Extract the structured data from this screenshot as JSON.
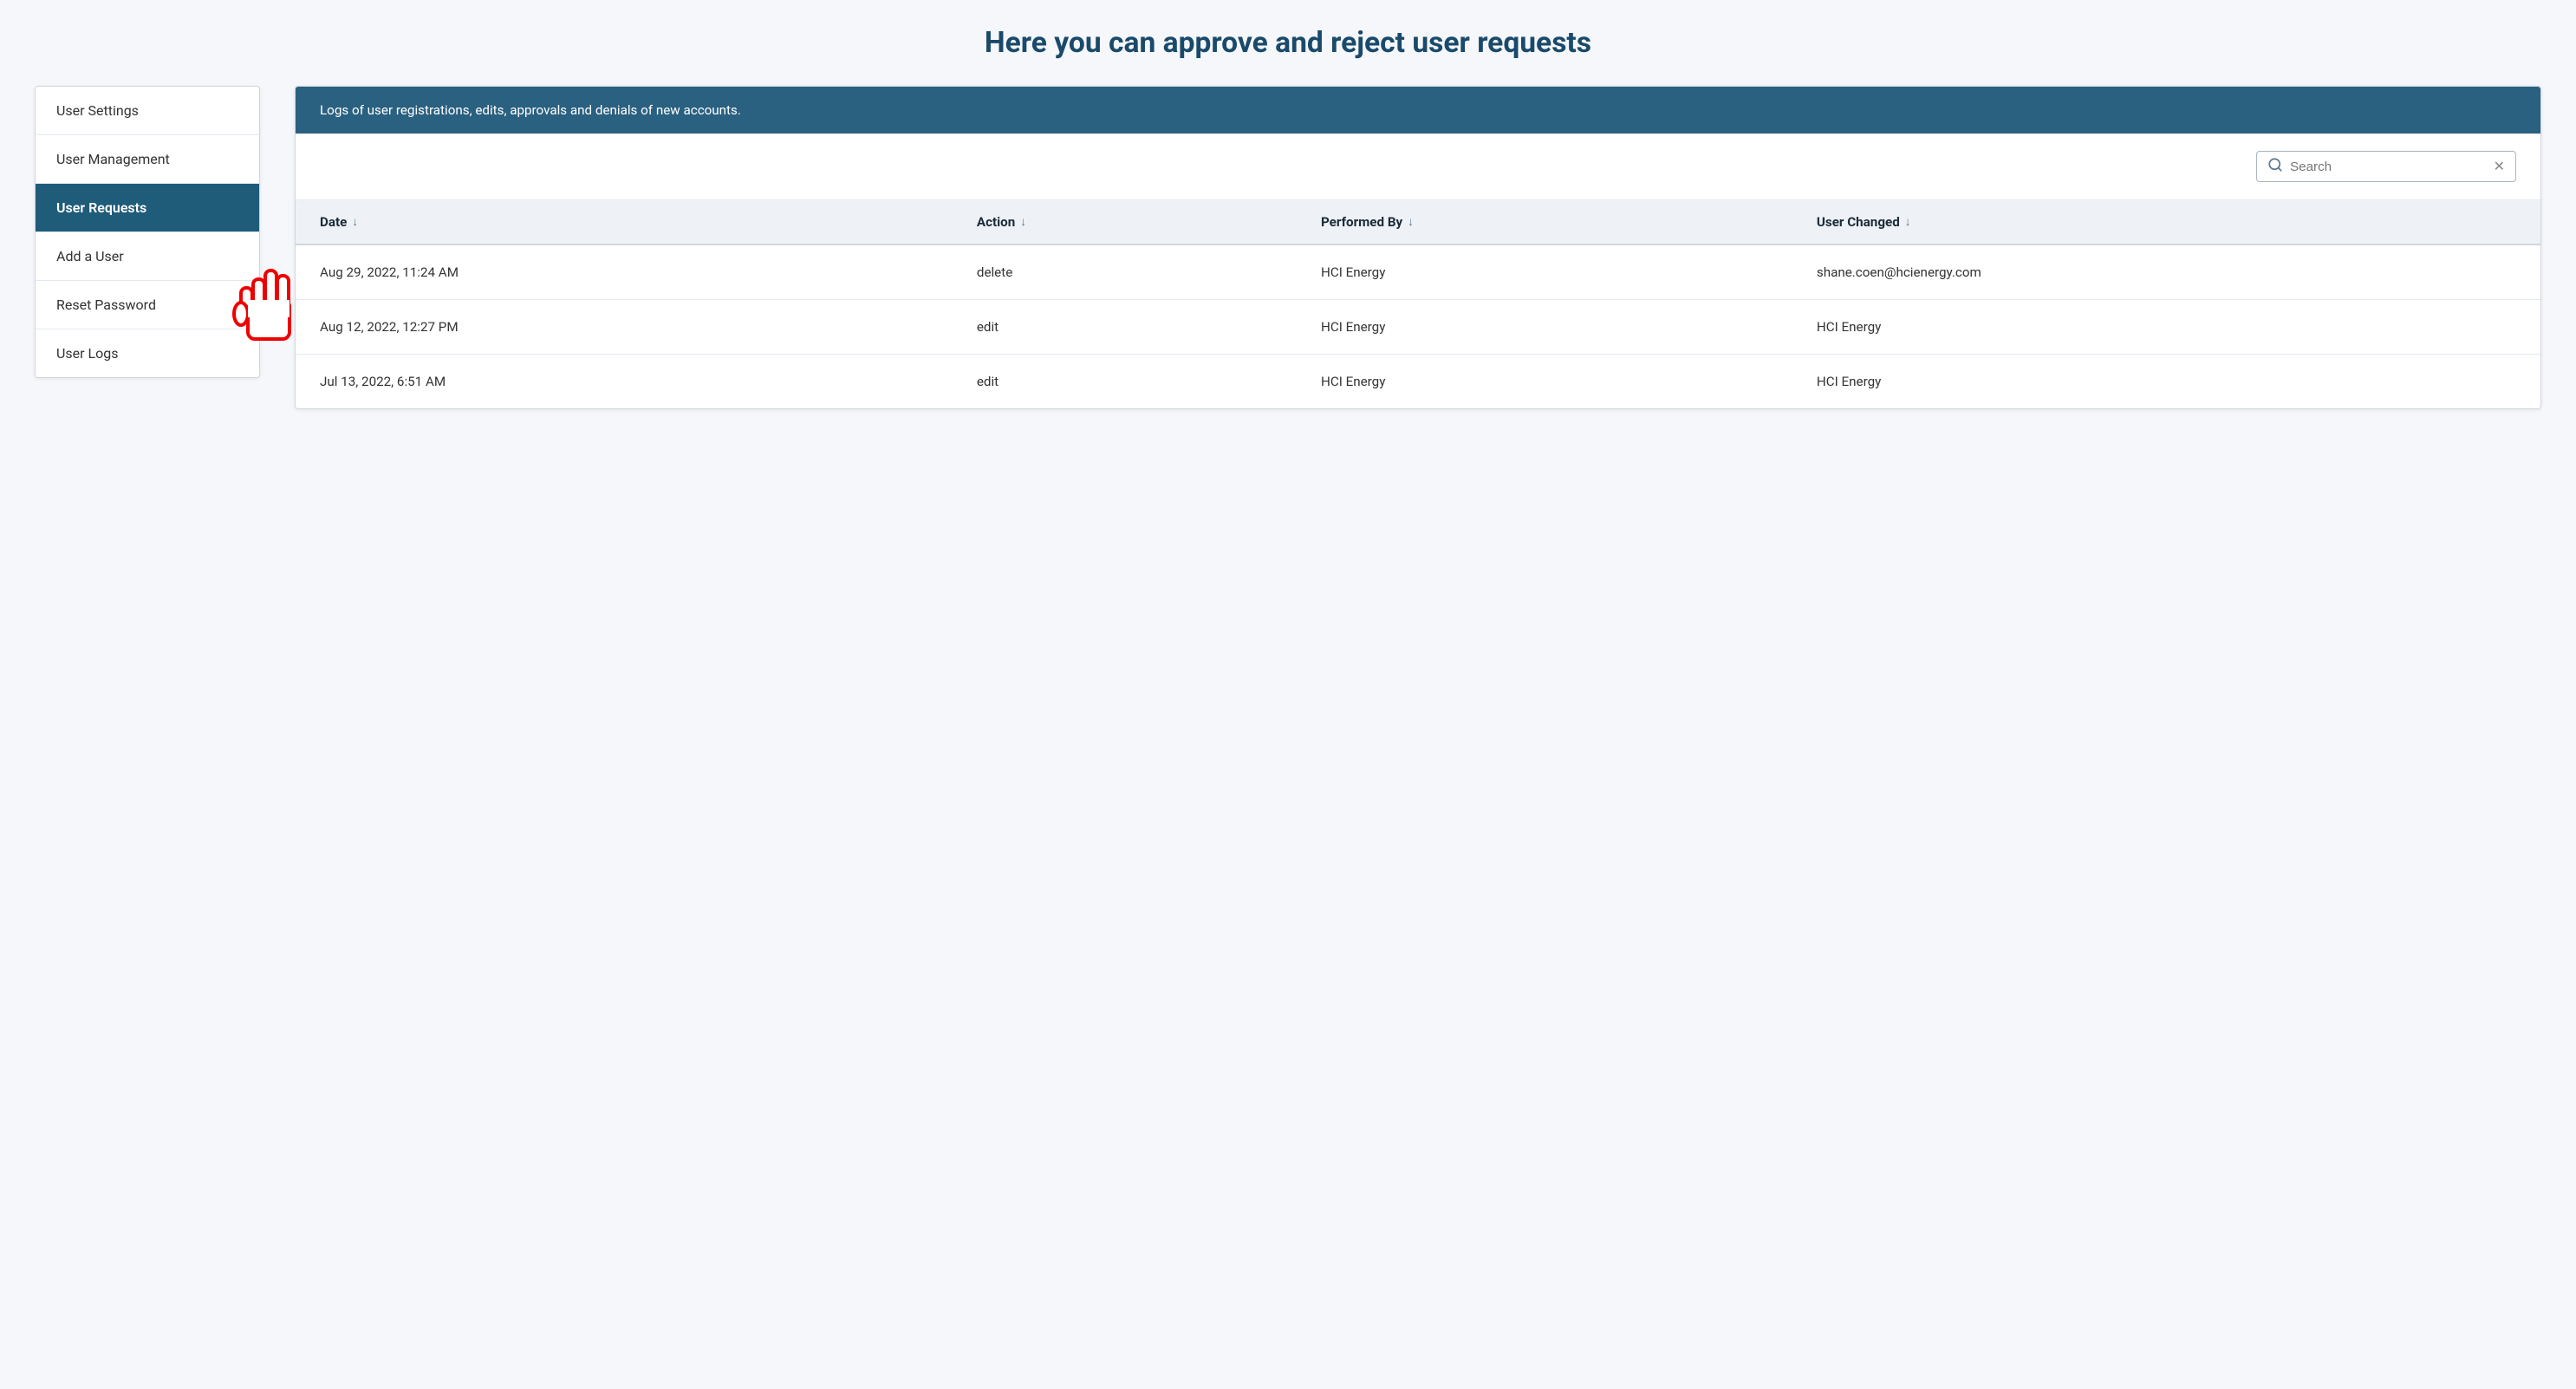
{
  "page": {
    "title": "Here you can approve and reject user requests"
  },
  "sidebar": {
    "items": [
      {
        "id": "user-settings",
        "label": "User Settings",
        "active": false
      },
      {
        "id": "user-management",
        "label": "User Management",
        "active": false
      },
      {
        "id": "user-requests",
        "label": "User Requests",
        "active": true
      },
      {
        "id": "add-a-user",
        "label": "Add a User",
        "active": false
      },
      {
        "id": "reset-password",
        "label": "Reset Password",
        "active": false
      },
      {
        "id": "user-logs",
        "label": "User Logs",
        "active": false
      }
    ]
  },
  "panel": {
    "header_text": "Logs of user registrations, edits, approvals and denials of new accounts.",
    "search": {
      "placeholder": "Search",
      "value": ""
    },
    "table": {
      "columns": [
        {
          "id": "date",
          "label": "Date"
        },
        {
          "id": "action",
          "label": "Action"
        },
        {
          "id": "performed_by",
          "label": "Performed By"
        },
        {
          "id": "user_changed",
          "label": "User Changed"
        }
      ],
      "rows": [
        {
          "date": "Aug 29, 2022, 11:24 AM",
          "action": "delete",
          "performed_by": "HCI Energy",
          "user_changed": "shane.coen@hcienergy.com"
        },
        {
          "date": "Aug 12, 2022, 12:27 PM",
          "action": "edit",
          "performed_by": "HCI Energy",
          "user_changed": "HCI Energy"
        },
        {
          "date": "Jul 13, 2022, 6:51 AM",
          "action": "edit",
          "performed_by": "HCI Energy",
          "user_changed": "HCI Energy"
        }
      ]
    }
  }
}
